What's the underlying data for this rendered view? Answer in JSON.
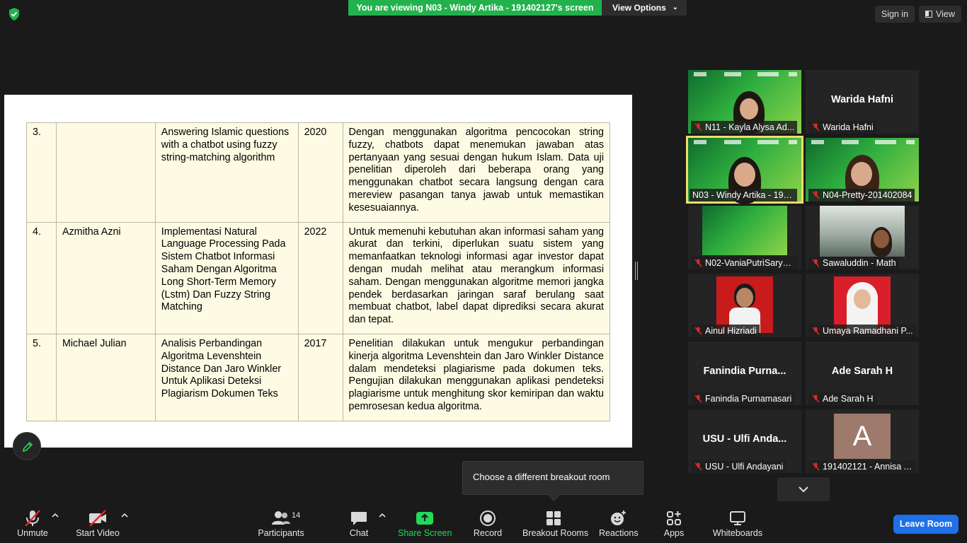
{
  "top_bar": {
    "banner_text": "You are viewing N03 - Windy Artika - 191402127's screen",
    "view_options_label": "View Options",
    "sign_in_label": "Sign in",
    "view_label": "View"
  },
  "document": {
    "rows": [
      {
        "no": "3.",
        "author": "",
        "title": "Answering Islamic questions with a chatbot using fuzzy string-matching algorithm",
        "year": "2020",
        "summary": "Dengan menggunakan algoritma pencocokan string fuzzy, chatbots dapat menemukan jawaban atas pertanyaan yang sesuai dengan hukum Islam. Data uji penelitian diperoleh dari beberapa orang yang menggunakan chatbot secara langsung dengan cara mereview pasangan tanya jawab untuk memastikan kesesuaiannya."
      },
      {
        "no": "4.",
        "author": "Azmitha Azni",
        "title": "Implementasi Natural Language Processing Pada Sistem Chatbot Informasi Saham Dengan Algoritma Long Short-Term Memory (Lstm) Dan Fuzzy String Matching",
        "year": "2022",
        "summary": "Untuk memenuhi kebutuhan akan informasi saham yang akurat dan terkini, diperlukan suatu sistem yang memanfaatkan teknologi informasi agar investor dapat dengan mudah melihat atau merangkum  informasi saham. Dengan menggunakan algoritme memori jangka pendek berdasarkan jaringan saraf berulang saat membuat chatbot, label dapat diprediksi secara akurat dan tepat."
      },
      {
        "no": "5.",
        "author": "Michael Julian",
        "title": "Analisis Perbandingan Algoritma Levenshtein Distance Dan Jaro Winkler Untuk Aplikasi Deteksi Plagiarism Dokumen Teks",
        "year": "2017",
        "summary": "Penelitian dilakukan untuk mengukur perbandingan kinerja algoritma Levenshtein dan  Jaro Winkler Distance dalam mendeteksi plagiarisme pada dokumen teks. Pengujian dilakukan menggunakan aplikasi pendeteksi plagiarisme untuk menghitung skor kemiripan dan waktu pemrosesan kedua algoritma."
      }
    ]
  },
  "gallery": [
    {
      "name": "N11 - Kayla Alysa Ad...",
      "big_name": ""
    },
    {
      "name": "Warida Hafni",
      "big_name": "Warida Hafni"
    },
    {
      "name": "N03 - Windy Artika - 191...",
      "big_name": ""
    },
    {
      "name": "N04-Pretty-201402084",
      "big_name": ""
    },
    {
      "name": "N02-VaniaPutriSaryan...",
      "big_name": ""
    },
    {
      "name": "Sawaluddin - Math",
      "big_name": ""
    },
    {
      "name": "Ainul Hizriadi",
      "big_name": ""
    },
    {
      "name": "Umaya Ramadhani P...",
      "big_name": ""
    },
    {
      "name": "Fanindia Purnamasari",
      "big_name": "Fanindia  Purna..."
    },
    {
      "name": "Ade Sarah H",
      "big_name": "Ade Sarah H"
    },
    {
      "name": "USU - Ulfi Andayani",
      "big_name": "USU - Ulfi Anda..."
    },
    {
      "name": "191402121 - Annisa A...",
      "big_name": "",
      "avatar_letter": "A"
    }
  ],
  "tooltip": {
    "text": "Choose a different breakout room"
  },
  "toolbar": {
    "unmute": "Unmute",
    "start_video": "Start Video",
    "participants": "Participants",
    "participants_count": "14",
    "chat": "Chat",
    "share_screen": "Share Screen",
    "record": "Record",
    "breakout_rooms": "Breakout Rooms",
    "reactions": "Reactions",
    "apps": "Apps",
    "whiteboards": "Whiteboards",
    "leave_room": "Leave Room"
  },
  "colors": {
    "banner_green": "#23b14d",
    "share_green": "#23d959",
    "leave_blue": "#1e6fe8",
    "muted_red": "#e02828",
    "active_speaker": "#f1dc6a"
  }
}
